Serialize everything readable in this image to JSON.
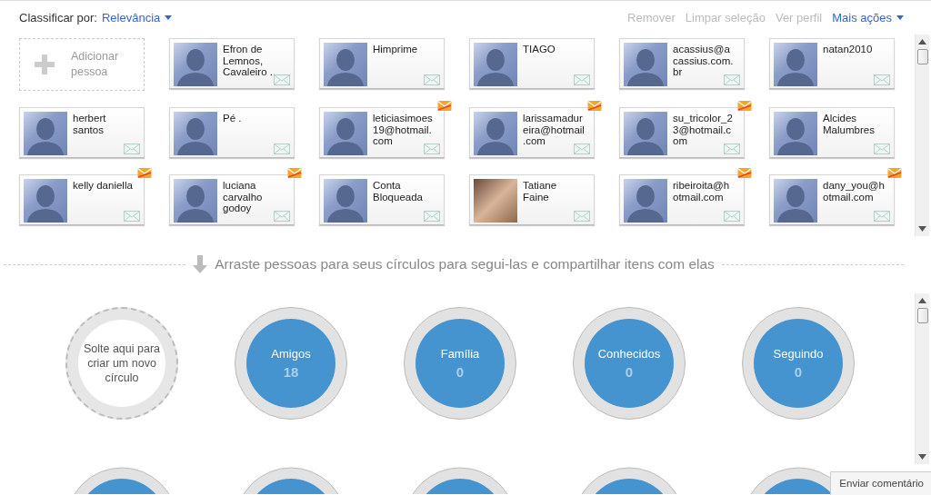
{
  "toolbar": {
    "sort_label": "Classificar por:",
    "sort_value": "Relevância",
    "actions": [
      {
        "label": "Remover",
        "disabled": true
      },
      {
        "label": "Limpar seleção",
        "disabled": true
      },
      {
        "label": "Ver perfil",
        "disabled": true
      },
      {
        "label": "Mais ações",
        "disabled": false,
        "dropdown": true
      }
    ]
  },
  "people": [
    {
      "kind": "add",
      "name": "Adicionar pessoa"
    },
    {
      "kind": "person",
      "name": "Efron de Lemnos, Cavaleiro ..",
      "photo": false,
      "badge": false
    },
    {
      "kind": "person",
      "name": "Himprime",
      "photo": false,
      "badge": false
    },
    {
      "kind": "person",
      "name": "TIAGO",
      "photo": false,
      "badge": false
    },
    {
      "kind": "person",
      "name": "acassius@acassius.com.br",
      "photo": false,
      "badge": false
    },
    {
      "kind": "person",
      "name": "natan2010",
      "photo": false,
      "badge": false
    },
    {
      "kind": "person",
      "name": "herbert santos",
      "photo": false,
      "badge": false
    },
    {
      "kind": "person",
      "name": "Pé .",
      "photo": false,
      "badge": false
    },
    {
      "kind": "person",
      "name": "leticiasimoes19@hotmail.com",
      "photo": false,
      "badge": true
    },
    {
      "kind": "person",
      "name": "larissamadureira@hotmail.com",
      "photo": false,
      "badge": true
    },
    {
      "kind": "person",
      "name": "su_tricolor_23@hotmail.com",
      "photo": false,
      "badge": true
    },
    {
      "kind": "person",
      "name": "Alcides Malumbres",
      "photo": false,
      "badge": false
    },
    {
      "kind": "person",
      "name": "kelly daniella",
      "photo": false,
      "badge": true
    },
    {
      "kind": "person",
      "name": "luciana carvalho godoy",
      "photo": false,
      "badge": true
    },
    {
      "kind": "person",
      "name": "Conta Bloqueada",
      "photo": false,
      "badge": false
    },
    {
      "kind": "person",
      "name": "Tatiane Faine",
      "photo": true,
      "badge": false
    },
    {
      "kind": "person",
      "name": "ribeiroita@hotmail.com",
      "photo": false,
      "badge": true
    },
    {
      "kind": "person",
      "name": "dany_you@hotmail.com",
      "photo": false,
      "badge": true
    }
  ],
  "hint": "Arraste pessoas para seus círculos para segui-las e compartilhar itens com elas",
  "circles": [
    {
      "kind": "drop",
      "label": "Solte aqui para criar um novo círculo"
    },
    {
      "kind": "circle",
      "label": "Amigos",
      "count": "18"
    },
    {
      "kind": "circle",
      "label": "Família",
      "count": "0"
    },
    {
      "kind": "circle",
      "label": "Conhecidos",
      "count": "0"
    },
    {
      "kind": "circle",
      "label": "Seguindo",
      "count": "0"
    }
  ],
  "feedback_button": "Enviar comentário"
}
